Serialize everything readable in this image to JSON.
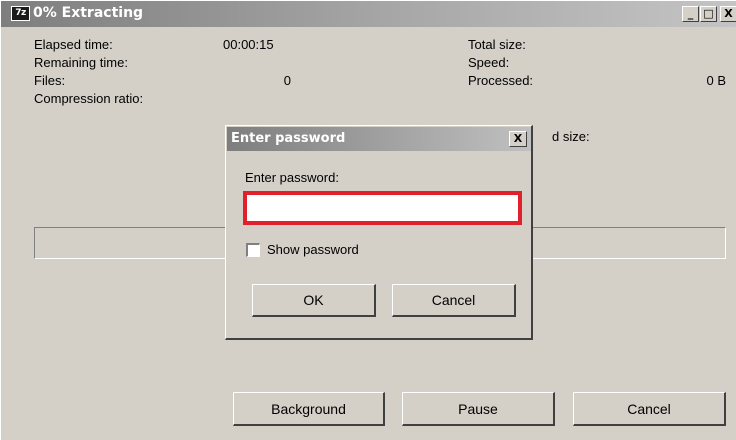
{
  "window": {
    "title": "0% Extracting",
    "app_icon_text": "7z",
    "controls": {
      "minimize": "_",
      "maximize": "□",
      "close": "X"
    }
  },
  "stats": {
    "elapsed_label": "Elapsed time:",
    "elapsed_value": "00:00:15",
    "remaining_label": "Remaining time:",
    "remaining_value": "",
    "files_label": "Files:",
    "files_value": "0",
    "compression_label": "Compression ratio:",
    "compression_value": "",
    "total_size_label": "Total size:",
    "total_size_value": "",
    "speed_label": "Speed:",
    "speed_value": "",
    "processed_label": "Processed:",
    "processed_value": "0 B",
    "packed_size_label_visible": "d size:"
  },
  "progress": {
    "percent": 0
  },
  "buttons": {
    "background": "Background",
    "pause": "Pause",
    "cancel": "Cancel"
  },
  "password_dialog": {
    "title": "Enter password",
    "close": "X",
    "prompt": "Enter password:",
    "input_value": "",
    "show_password_label": "Show password",
    "show_password_checked": false,
    "ok": "OK",
    "cancel": "Cancel",
    "highlight_color": "#e0202a"
  }
}
